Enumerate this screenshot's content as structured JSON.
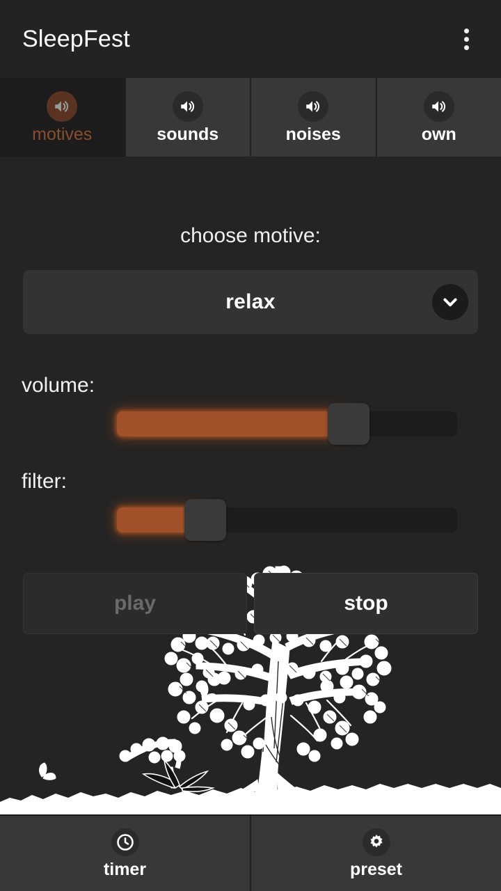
{
  "app": {
    "title": "SleepFest",
    "overflow_icon": "more-vertical-icon",
    "accent_color": "#a0512a",
    "background_color": "#242424"
  },
  "tabs": [
    {
      "label": "motives",
      "icon": "speaker-icon",
      "active": true
    },
    {
      "label": "sounds",
      "icon": "speaker-icon",
      "active": false
    },
    {
      "label": "noises",
      "icon": "speaker-icon",
      "active": false
    },
    {
      "label": "own",
      "icon": "speaker-icon",
      "active": false
    }
  ],
  "main": {
    "choose_label": "choose motive:",
    "dropdown": {
      "value": "relax",
      "arrow_icon": "chevron-down-icon"
    },
    "volume": {
      "label": "volume:",
      "percent": 68
    },
    "filter": {
      "label": "filter:",
      "percent": 26
    },
    "buttons": {
      "play": "play",
      "play_enabled": false,
      "stop": "stop",
      "stop_enabled": true
    },
    "illustration": "blossoming-tree-line-art"
  },
  "bottom_nav": [
    {
      "label": "timer",
      "icon": "clock-icon"
    },
    {
      "label": "preset",
      "icon": "gear-icon"
    }
  ]
}
